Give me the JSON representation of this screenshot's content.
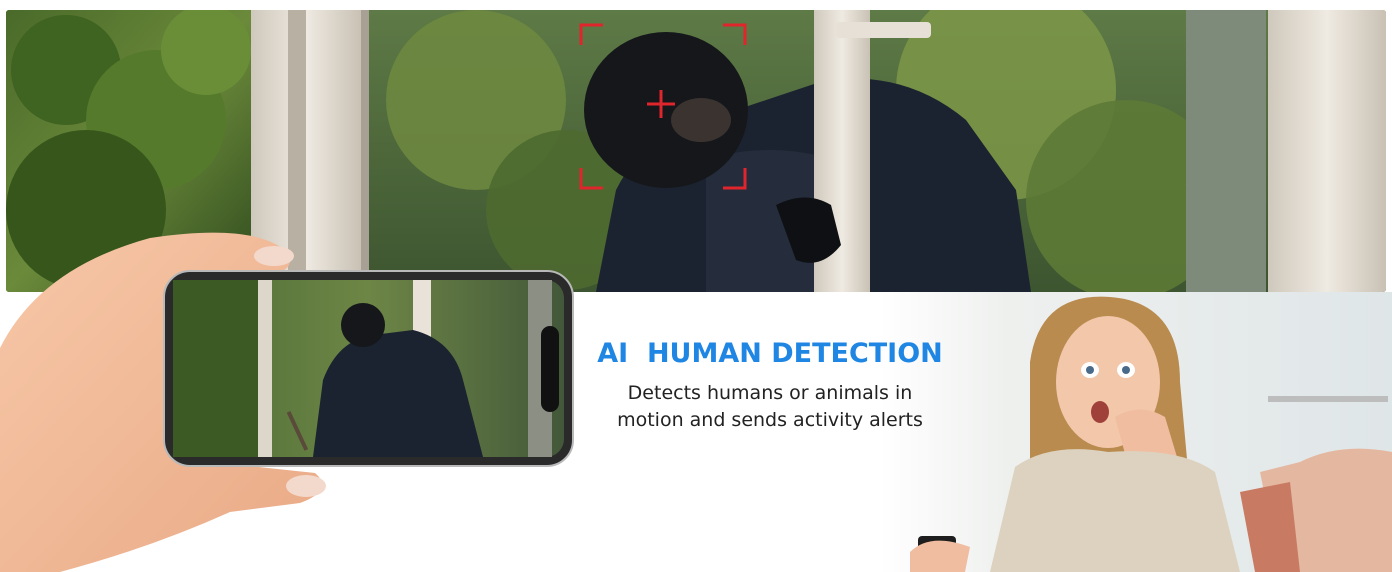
{
  "feature": {
    "title": "AI  HUMAN DETECTION",
    "description_line1": "Detects humans or animals in",
    "description_line2": "motion and sends activity alerts"
  },
  "colors": {
    "title": "#1f86e3",
    "description": "#222222",
    "detection_frame": "#e0262c"
  },
  "icons": [
    "detection-frame-icon",
    "crosshair-icon"
  ]
}
